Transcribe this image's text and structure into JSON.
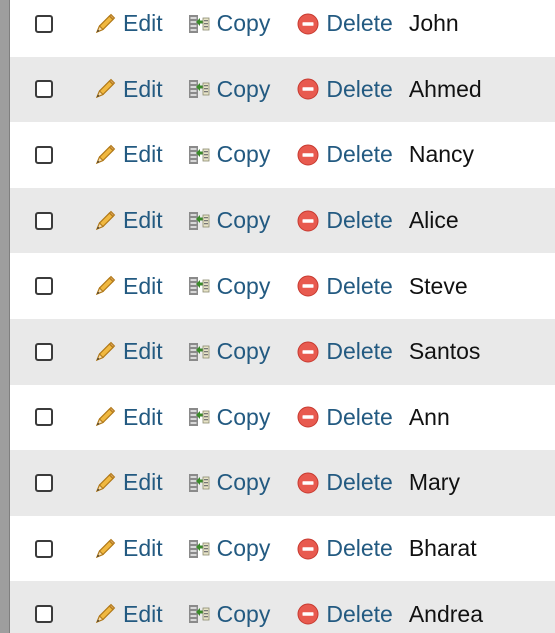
{
  "actions": {
    "edit": "Edit",
    "copy": "Copy",
    "delete": "Delete"
  },
  "rows": [
    {
      "name": "John"
    },
    {
      "name": "Ahmed"
    },
    {
      "name": "Nancy"
    },
    {
      "name": "Alice"
    },
    {
      "name": "Steve"
    },
    {
      "name": "Santos"
    },
    {
      "name": "Ann"
    },
    {
      "name": "Mary"
    },
    {
      "name": "Bharat"
    },
    {
      "name": "Andrea"
    }
  ],
  "colors": {
    "link": "#235a81",
    "row_alt": "#e9e9e9",
    "delete_icon": "#e85a4f",
    "edit_icon": "#e0a030"
  }
}
